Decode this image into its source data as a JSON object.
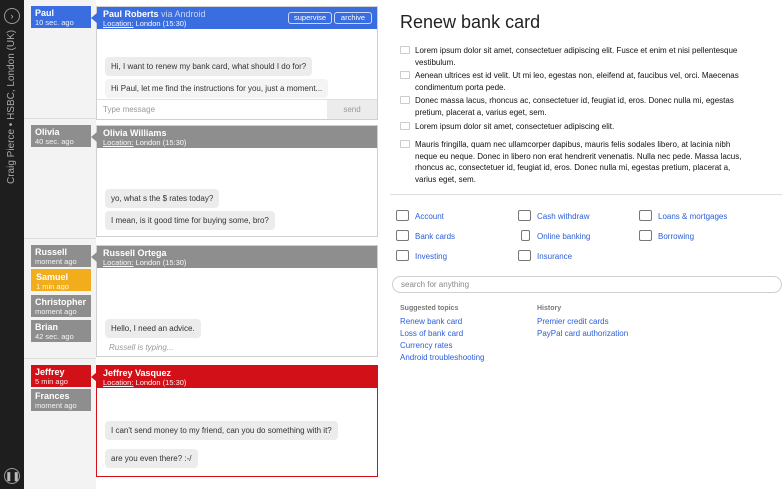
{
  "sidebar": {
    "agent_info": "Craig Pierce • HSBC, London (UK)",
    "top_button_icon": "chevron-right-icon",
    "bottom_button_icon": "pause-icon"
  },
  "users": [
    {
      "name": "Paul",
      "time": "10 sec. ago",
      "color": "#3a6ee0"
    },
    {
      "name": "Olivia",
      "time": "40 sec. ago",
      "color": "#8e8e8e"
    },
    {
      "name": "Russell",
      "time": "moment ago",
      "color": "#8e8e8e"
    },
    {
      "name": "Samuel",
      "time": "1 min ago",
      "color": "#f2ad1d"
    },
    {
      "name": "Christopher",
      "time": "moment ago",
      "color": "#8e8e8e"
    },
    {
      "name": "Brian",
      "time": "42 sec. ago",
      "color": "#8e8e8e"
    },
    {
      "name": "Jeffrey",
      "time": "5 min ago",
      "color": "#d21017"
    },
    {
      "name": "Frances",
      "time": "moment ago",
      "color": "#8e8e8e"
    }
  ],
  "chats": {
    "paul": {
      "name": "Paul Roberts",
      "via": "via Android",
      "location_label": "Location:",
      "location": "London (15:30)",
      "supervise_label": "supervise",
      "archive_label": "archive",
      "messages": [
        "Hi, I want to renew my bank card, what should I do for?",
        "Hi Paul, let me find the instructions for you, just a moment..."
      ],
      "input_placeholder": "Type message",
      "send_label": "send"
    },
    "olivia": {
      "name": "Olivia Williams",
      "location_label": "Location:",
      "location": "London (15:30)",
      "messages": [
        "yo, what s the $ rates today?",
        "I mean, is it good time for buying some, bro?"
      ]
    },
    "russell": {
      "name": "Russell Ortega",
      "location_label": "Location:",
      "location": "London (15:30)",
      "messages": [
        "Hello, I need an advice."
      ],
      "typing": "Russell is typing..."
    },
    "jeffrey": {
      "name": "Jeffrey Vasquez",
      "location_label": "Location:",
      "location": "London (15:30)",
      "messages": [
        "I can't send money to my friend, can you do something with it?",
        "are you even there? :-/"
      ]
    }
  },
  "knowledge": {
    "title": "Renew bank card",
    "items": [
      "Lorem ipsum dolor sit amet, consectetuer adipiscing elit. Fusce et enim et nisi pellentesque vestibulum.",
      "Aenean ultrices est id velit. Ut mi leo, egestas non, eleifend at, faucibus vel, orci. Maecenas condimentum porta pede.",
      "Donec massa lacus, rhoncus ac, consectetuer id, feugiat id, eros. Donec nulla mi, egestas pretium, placerat a, varius eget, sem.",
      "Lorem ipsum dolor sit amet, consectetuer adipiscing elit.",
      "Mauris fringilla, quam nec ullamcorper dapibus, mauris felis sodales libero, at lacinia nibh neque eu neque. Donec in libero non erat hendrerit venenatis. Nulla nec pede. Massa lacus, rhoncus ac, consectetuer id, feugiat id, eros. Donec nulla mi, egestas pretium, placerat a, varius eget, sem."
    ],
    "categories": [
      {
        "label": "Account",
        "icon": "account-icon"
      },
      {
        "label": "Cash withdraw",
        "icon": "cash-icon"
      },
      {
        "label": "Loans & mortgages",
        "icon": "house-icon"
      },
      {
        "label": "Bank cards",
        "icon": "card-icon"
      },
      {
        "label": "Online banking",
        "icon": "mouse-icon"
      },
      {
        "label": "Borrowing",
        "icon": "borrowing-icon"
      },
      {
        "label": "Investing",
        "icon": "investing-icon"
      },
      {
        "label": "Insurance",
        "icon": "insurance-icon"
      }
    ],
    "search_placeholder": "search for anything",
    "suggested_heading": "Suggested topics",
    "suggested": [
      "Renew bank card",
      "Loss of bank card",
      "Currency rates",
      "Android troubleshooting"
    ],
    "history_heading": "History",
    "history": [
      "Premier credit cards",
      "PayPal card authorization"
    ]
  }
}
